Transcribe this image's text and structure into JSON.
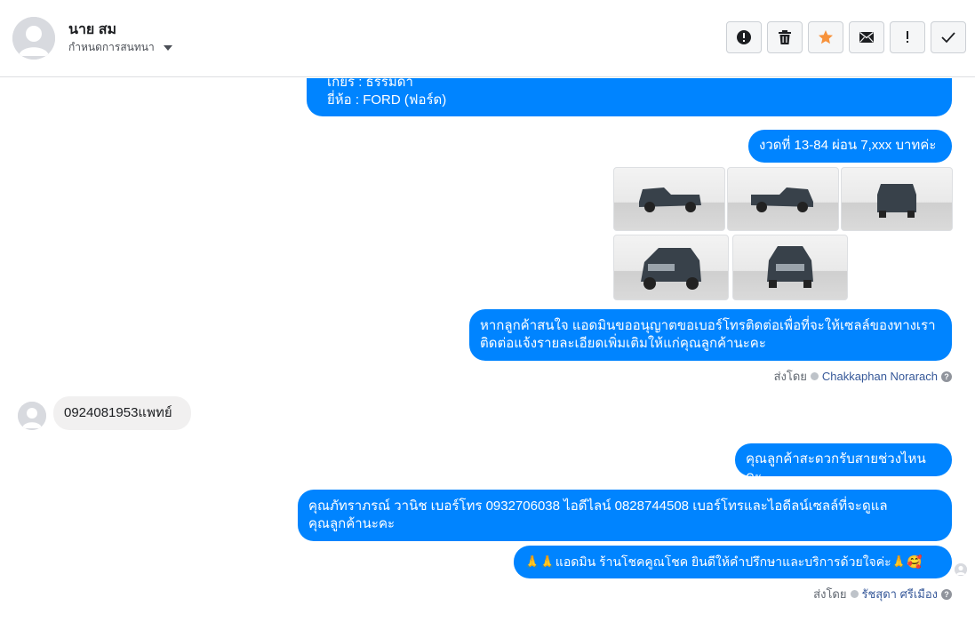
{
  "header": {
    "contact_name": "นาย สม",
    "assign_label": "กำหนดการสนทนา",
    "actions": [
      {
        "name": "spam-button",
        "icon": "alert-circle-icon"
      },
      {
        "name": "delete-button",
        "icon": "trash-icon"
      },
      {
        "name": "star-button",
        "icon": "star-icon"
      },
      {
        "name": "mark-unread-button",
        "icon": "envelope-icon"
      },
      {
        "name": "follow-up-button",
        "icon": "exclamation-icon"
      },
      {
        "name": "done-button",
        "icon": "check-icon"
      }
    ]
  },
  "colors": {
    "outgoing_bubble": "#0084ff",
    "incoming_bubble": "#f1f0f0",
    "star": "#f7923b",
    "link": "#365899"
  },
  "thread": {
    "msg_partial": "เกียร์ : ธรรมดา\nยี่ห้อ : FORD (ฟอร์ด)",
    "msg_installment": "งวดที่ 13-84 ผ่อน 7,xxx บาทค่ะ",
    "photos": [
      {
        "name": "truck-photo-side-1"
      },
      {
        "name": "truck-photo-side-2"
      },
      {
        "name": "truck-photo-rear"
      },
      {
        "name": "truck-photo-front-quarter"
      },
      {
        "name": "truck-photo-front"
      }
    ],
    "msg_contact_permission": "หากลูกค้าสนใจ แอดมินขออนุญาตขอเบอร์โทรติดต่อเพื่อที่จะให้เซลล์ของทางเรา\nติดต่อแจ้งรายละเอียดเพิ่มเติมให้แก่คุณลูกค้านะคะ",
    "sent_by_1": {
      "prefix": "ส่งโดย",
      "name": "Chakkaphan Norarach"
    },
    "msg_incoming_phone": "0924081953แพทย์",
    "msg_convenient_time": "คุณลูกค้าสะดวกรับสายช่วงไหนคะ",
    "msg_sales_contact": "คุณภัทราภรณ์  วานิช      เบอร์โทร 0932706038  ไอดีไลน์ 0828744508   เบอร์โทรและไอดีลน์เซลล์ที่จะดูแล\nคุณลูกค้านะคะ",
    "msg_closing": "🙏🙏แอดมิน ร้านโชคคูณโชค ยินดีให้คำปรึกษาและบริการด้วยใจค่ะ🙏🥰",
    "sent_by_2": {
      "prefix": "ส่งโดย",
      "name": "รัชสุดา ศรีเมือง"
    }
  }
}
